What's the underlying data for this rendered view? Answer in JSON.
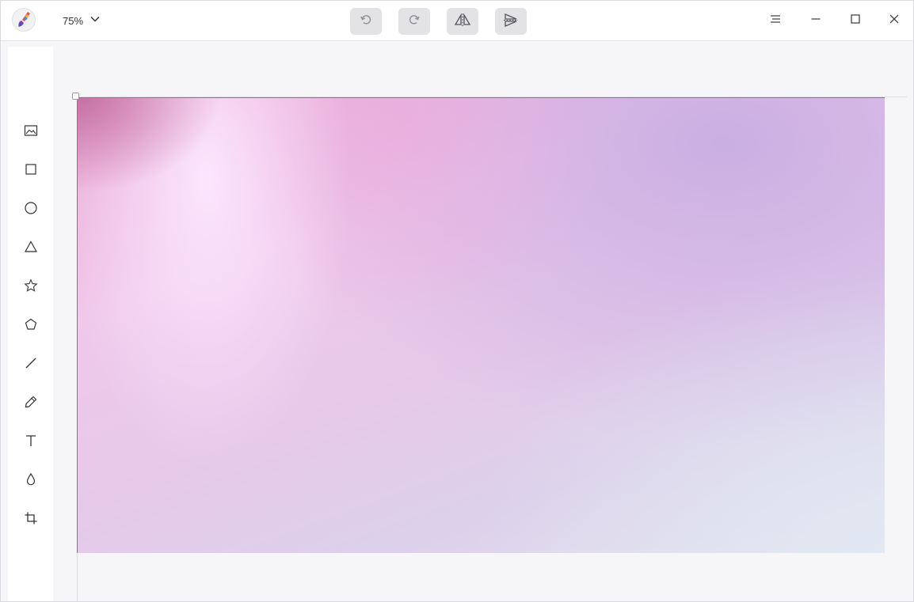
{
  "app": {
    "logo_icon": "paintbrush-icon",
    "zoom_label": "75%",
    "zoom_dropdown_icon": "chevron-down-icon"
  },
  "toolbar": {
    "undo_icon": "undo-icon",
    "redo_icon": "redo-icon",
    "flip_icon": "flip-horizontal-icon",
    "flip_vertical_icon": "flip-vertical-icon"
  },
  "window_controls": {
    "menu_icon": "hamburger-menu-icon",
    "minimize_icon": "minimize-icon",
    "maximize_icon": "maximize-icon",
    "close_icon": "close-icon"
  },
  "tools": [
    {
      "name": "image",
      "icon": "image-icon"
    },
    {
      "name": "rectangle",
      "icon": "rectangle-icon"
    },
    {
      "name": "ellipse",
      "icon": "circle-icon"
    },
    {
      "name": "triangle",
      "icon": "triangle-icon"
    },
    {
      "name": "star",
      "icon": "star-icon"
    },
    {
      "name": "polygon",
      "icon": "pentagon-icon"
    },
    {
      "name": "line",
      "icon": "line-icon"
    },
    {
      "name": "pencil",
      "icon": "pencil-icon"
    },
    {
      "name": "text",
      "icon": "text-icon"
    },
    {
      "name": "blur",
      "icon": "droplet-icon"
    },
    {
      "name": "crop",
      "icon": "crop-icon"
    }
  ],
  "colors": {
    "accent_border": "#5b7fd1",
    "button_bg": "#e3e3e6",
    "canvas_bg": "#f6f6f8"
  }
}
